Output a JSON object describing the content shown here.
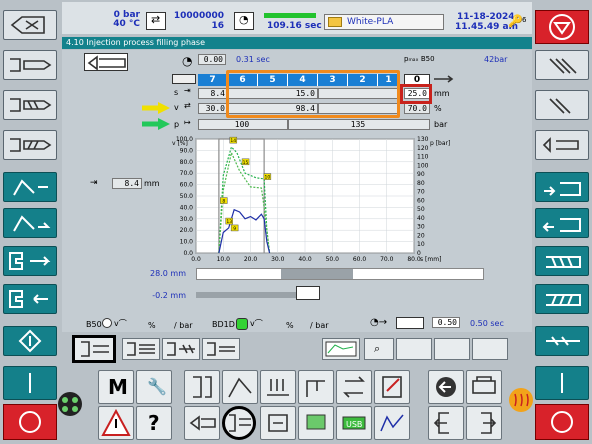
{
  "status": {
    "pressure": "0 bar",
    "temp": "40 °C",
    "counter_top": "10000000",
    "counter_bottom": "16",
    "cycle_time": "109.16 sec",
    "material": "White-PLA",
    "date": "11-18-2024",
    "time": "11.45.49 am",
    "key_level": "6"
  },
  "page_title": "4.10 Injection process filling phase",
  "injection": {
    "time_value": "0.00",
    "time_actual": "0.31 sec",
    "pmax_label": "pₘₐₓ B50",
    "pmax_value": "42bar",
    "zones": [
      "7",
      "6",
      "5",
      "4",
      "3",
      "2",
      "1",
      "0"
    ],
    "stroke_label": "s",
    "stroke_values": [
      "8.4",
      "15.0",
      "25.0"
    ],
    "stroke_unit": "mm",
    "speed_label": "v",
    "speed_values": [
      "30.0",
      "98.4",
      "70.0"
    ],
    "speed_unit": "%",
    "pressure_label": "p",
    "pressure_values": [
      "100",
      "135"
    ],
    "pressure_unit": "bar",
    "switchover_value": "8.4",
    "switchover_unit": "mm"
  },
  "chart_data": {
    "type": "line",
    "xlabel": "s [mm]",
    "ylabel_left": "v [%]",
    "ylabel_right": "p [bar]",
    "x_ticks": [
      "0.0",
      "10.0",
      "20.0",
      "30.0",
      "40.0",
      "50.0",
      "60.0",
      "70.0",
      "80.0"
    ],
    "y_left_ticks": [
      "0.0",
      "10.0",
      "20.0",
      "30.0",
      "40.0",
      "50.0",
      "60.0",
      "70.0",
      "80.0",
      "90.0",
      "100.0"
    ],
    "y_right_ticks": [
      "0",
      "10",
      "20",
      "30",
      "40",
      "50",
      "60",
      "70",
      "80",
      "90",
      "100",
      "110",
      "120",
      "130"
    ],
    "xlim": [
      0,
      80
    ],
    "ylim_left": [
      0,
      100
    ],
    "ylim_right": [
      0,
      130
    ],
    "markers": [
      "14",
      "15",
      "13",
      "8",
      "10",
      "9"
    ],
    "series": [
      {
        "color": "#8c8c8c",
        "values": [
          [
            8.4,
            0
          ],
          [
            8.4,
            100
          ],
          [
            12,
            100
          ],
          [
            13,
            100
          ],
          [
            25,
            100
          ],
          [
            25,
            0
          ]
        ]
      },
      {
        "color": "#22b14c",
        "values": [
          [
            8.4,
            0
          ],
          [
            10,
            68
          ],
          [
            13,
            93
          ],
          [
            15,
            88
          ],
          [
            18,
            70
          ],
          [
            22,
            66
          ],
          [
            25,
            65
          ],
          [
            26,
            20
          ],
          [
            27,
            0
          ]
        ]
      },
      {
        "color": "#4cb84c",
        "values": [
          [
            8.4,
            0
          ],
          [
            10,
            55
          ],
          [
            13,
            88
          ],
          [
            16,
            72
          ],
          [
            20,
            58
          ],
          [
            24,
            57
          ],
          [
            25,
            40
          ],
          [
            27,
            0
          ]
        ]
      },
      {
        "color": "#1f2fa8",
        "values": [
          [
            8.4,
            0
          ],
          [
            10,
            18
          ],
          [
            12,
            22
          ],
          [
            14,
            38
          ],
          [
            16,
            36
          ],
          [
            18,
            30
          ],
          [
            20,
            32
          ],
          [
            22,
            29
          ],
          [
            24,
            34
          ],
          [
            25,
            30
          ],
          [
            26,
            10
          ],
          [
            27,
            0
          ]
        ]
      }
    ]
  },
  "screw": {
    "position": "28.0 mm",
    "offset": "-0.2 mm"
  },
  "lower": {
    "b50_label": "B50",
    "b50_unit1": "%",
    "b50_unit2": "/ bar",
    "bd10_label": "BD1D",
    "bd10_unit1": "%",
    "bd10_unit2": "/ bar",
    "delay_value": "0.50",
    "delay_actual": "0.50 sec"
  },
  "toolbar": {
    "m_label": "M",
    "help_label": "?"
  }
}
